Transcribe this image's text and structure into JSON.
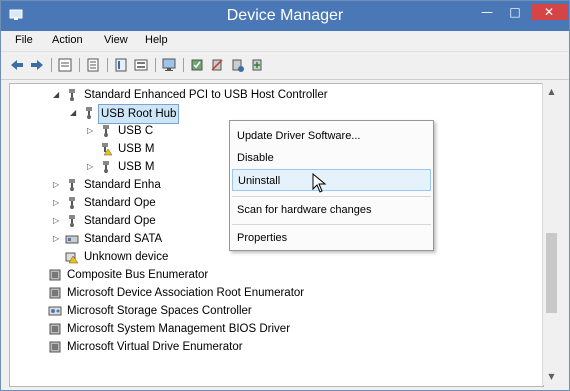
{
  "window": {
    "title": "Device Manager",
    "minimize": "—",
    "maximize": "□",
    "close": "✕"
  },
  "menu": [
    "File",
    "Action",
    "View",
    "Help"
  ],
  "toolbar": [
    "back-icon",
    "forward-icon",
    "properties-icon",
    "update-icon",
    "help-icon",
    "scan-icon",
    "computer-icon",
    "uninstall-icon",
    "disable-icon",
    "enable-icon"
  ],
  "tree": [
    {
      "label": "Standard Enhanced PCI to USB Host Controller",
      "expander": "◢",
      "indent": 3,
      "icon": "usb-icon"
    },
    {
      "label": "USB Root Hub",
      "expander": "◢",
      "indent": 4,
      "icon": "usb-icon",
      "selected": true
    },
    {
      "label": "USB C",
      "expander": "▷",
      "indent": 5,
      "icon": "usb-icon"
    },
    {
      "label": "USB M",
      "expander": "",
      "indent": 5,
      "icon": "usb-warning-icon"
    },
    {
      "label": "USB M",
      "expander": "▷",
      "indent": 5,
      "icon": "usb-icon"
    },
    {
      "label": "Standard Enha",
      "expander": "▷",
      "indent": 3,
      "icon": "usb-icon"
    },
    {
      "label": "Standard Ope",
      "expander": "▷",
      "indent": 3,
      "icon": "usb-icon"
    },
    {
      "label": "Standard Ope",
      "expander": "▷",
      "indent": 3,
      "icon": "usb-icon"
    },
    {
      "label": "Standard SATA",
      "expander": "▷",
      "indent": 3,
      "icon": "storage-icon"
    },
    {
      "label": "Unknown device",
      "expander": "",
      "indent": 3,
      "icon": "unknown-device-icon"
    },
    {
      "label": "Composite Bus Enumerator",
      "expander": "",
      "indent": 2,
      "icon": "device-icon"
    },
    {
      "label": "Microsoft Device Association Root Enumerator",
      "expander": "",
      "indent": 2,
      "icon": "device-icon"
    },
    {
      "label": "Microsoft Storage Spaces Controller",
      "expander": "",
      "indent": 2,
      "icon": "storage-controller-icon"
    },
    {
      "label": "Microsoft System Management BIOS Driver",
      "expander": "",
      "indent": 2,
      "icon": "device-icon"
    },
    {
      "label": "Microsoft Virtual Drive Enumerator",
      "expander": "",
      "indent": 2,
      "icon": "device-icon"
    }
  ],
  "context_menu": {
    "update": "Update Driver Software...",
    "disable": "Disable",
    "uninstall": "Uninstall",
    "scan": "Scan for hardware changes",
    "properties": "Properties"
  },
  "colors": {
    "titlebar": "#4a78b6",
    "close": "#d64545",
    "selection": "#cde6f7",
    "highlight": "#e5f1fb"
  }
}
